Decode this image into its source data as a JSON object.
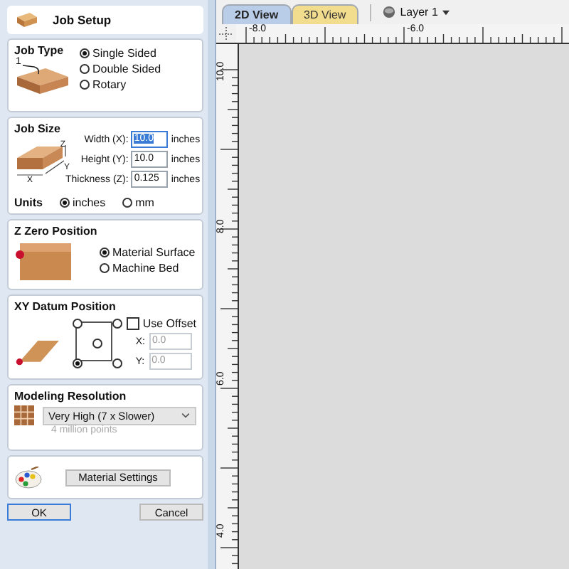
{
  "panel": {
    "title": "Job Setup"
  },
  "job_type": {
    "heading": "Job Type",
    "image_label": "1",
    "options": [
      {
        "label": "Single Sided",
        "selected": true
      },
      {
        "label": "Double Sided",
        "selected": false
      },
      {
        "label": "Rotary",
        "selected": false
      }
    ]
  },
  "job_size": {
    "heading": "Job Size",
    "axis_labels": [
      "Z",
      "Y",
      "X"
    ],
    "fields": [
      {
        "label": "Width (X):",
        "value": "10.0",
        "unit": "inches",
        "focused": true
      },
      {
        "label": "Height (Y):",
        "value": "10.0",
        "unit": "inches",
        "focused": false
      },
      {
        "label": "Thickness (Z):",
        "value": "0.125",
        "unit": "inches",
        "focused": false
      }
    ],
    "units": {
      "label": "Units",
      "options": [
        {
          "label": "inches",
          "selected": true
        },
        {
          "label": "mm",
          "selected": false
        }
      ]
    }
  },
  "z_zero": {
    "heading": "Z Zero Position",
    "options": [
      {
        "label": "Material Surface",
        "selected": true
      },
      {
        "label": "Machine Bed",
        "selected": false
      }
    ]
  },
  "xy_datum": {
    "heading": "XY Datum Position",
    "points": [
      {
        "selected": false
      },
      {
        "selected": false
      },
      {
        "selected": false
      },
      {
        "selected": true
      },
      {
        "selected": false
      }
    ],
    "use_offset": {
      "label": "Use Offset",
      "checked": false
    },
    "offset_fields": [
      {
        "label": "X:",
        "value": "0.0",
        "disabled": true
      },
      {
        "label": "Y:",
        "value": "0.0",
        "disabled": true
      }
    ]
  },
  "modeling_resolution": {
    "heading": "Modeling Resolution",
    "dropdown": "Very High (7 x Slower)",
    "note": "4 million points"
  },
  "material": {
    "button": "Material Settings"
  },
  "buttons": [
    {
      "label": "OK",
      "focused": true
    },
    {
      "label": "Cancel",
      "focused": false
    }
  ],
  "view_tabs": [
    {
      "label": "2D View",
      "selected": true,
      "color": "#b9cde9"
    },
    {
      "label": "3D View",
      "selected": false,
      "color": "#f2dc8e"
    }
  ],
  "layer": {
    "label": "Layer 1"
  },
  "rulers": {
    "horizontal": [
      "-8.0",
      "-6.0"
    ],
    "vertical": [
      "10.0",
      "8.0",
      "6.0",
      "4.0"
    ]
  }
}
